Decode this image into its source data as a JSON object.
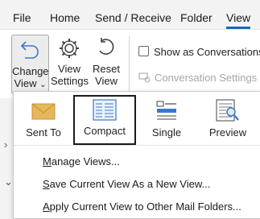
{
  "tabs": [
    {
      "label": "File"
    },
    {
      "label": "Home"
    },
    {
      "label": "Send / Receive"
    },
    {
      "label": "Folder"
    },
    {
      "label": "View"
    }
  ],
  "ribbon": {
    "change_view": {
      "line1": "Change",
      "line2": "View",
      "caret": "⌄"
    },
    "view_settings": {
      "line1": "View",
      "line2": "Settings"
    },
    "reset_view": {
      "line1": "Reset",
      "line2": "View"
    },
    "show_as_conversations": {
      "label": "Show as Conversations",
      "checked": false
    },
    "conversation_settings": {
      "label": "Conversation Settings",
      "caret": "⌄",
      "enabled": false
    }
  },
  "left_chevrons": [
    "›",
    "⌄"
  ],
  "dropdown": {
    "views": [
      {
        "label": "Sent To"
      },
      {
        "label": "Compact",
        "selected": true
      },
      {
        "label": "Single"
      },
      {
        "label": "Preview"
      }
    ],
    "menu": [
      {
        "pre": "",
        "key": "M",
        "post": "anage Views..."
      },
      {
        "pre": "",
        "key": "S",
        "post": "ave Current View As a New View..."
      },
      {
        "pre": "",
        "key": "A",
        "post": "pply Current View to Other Mail Folders..."
      }
    ]
  },
  "colors": {
    "accent": "#0f6cbd",
    "envelope": "#d9a74a",
    "icon_blue": "#3c78c8"
  }
}
